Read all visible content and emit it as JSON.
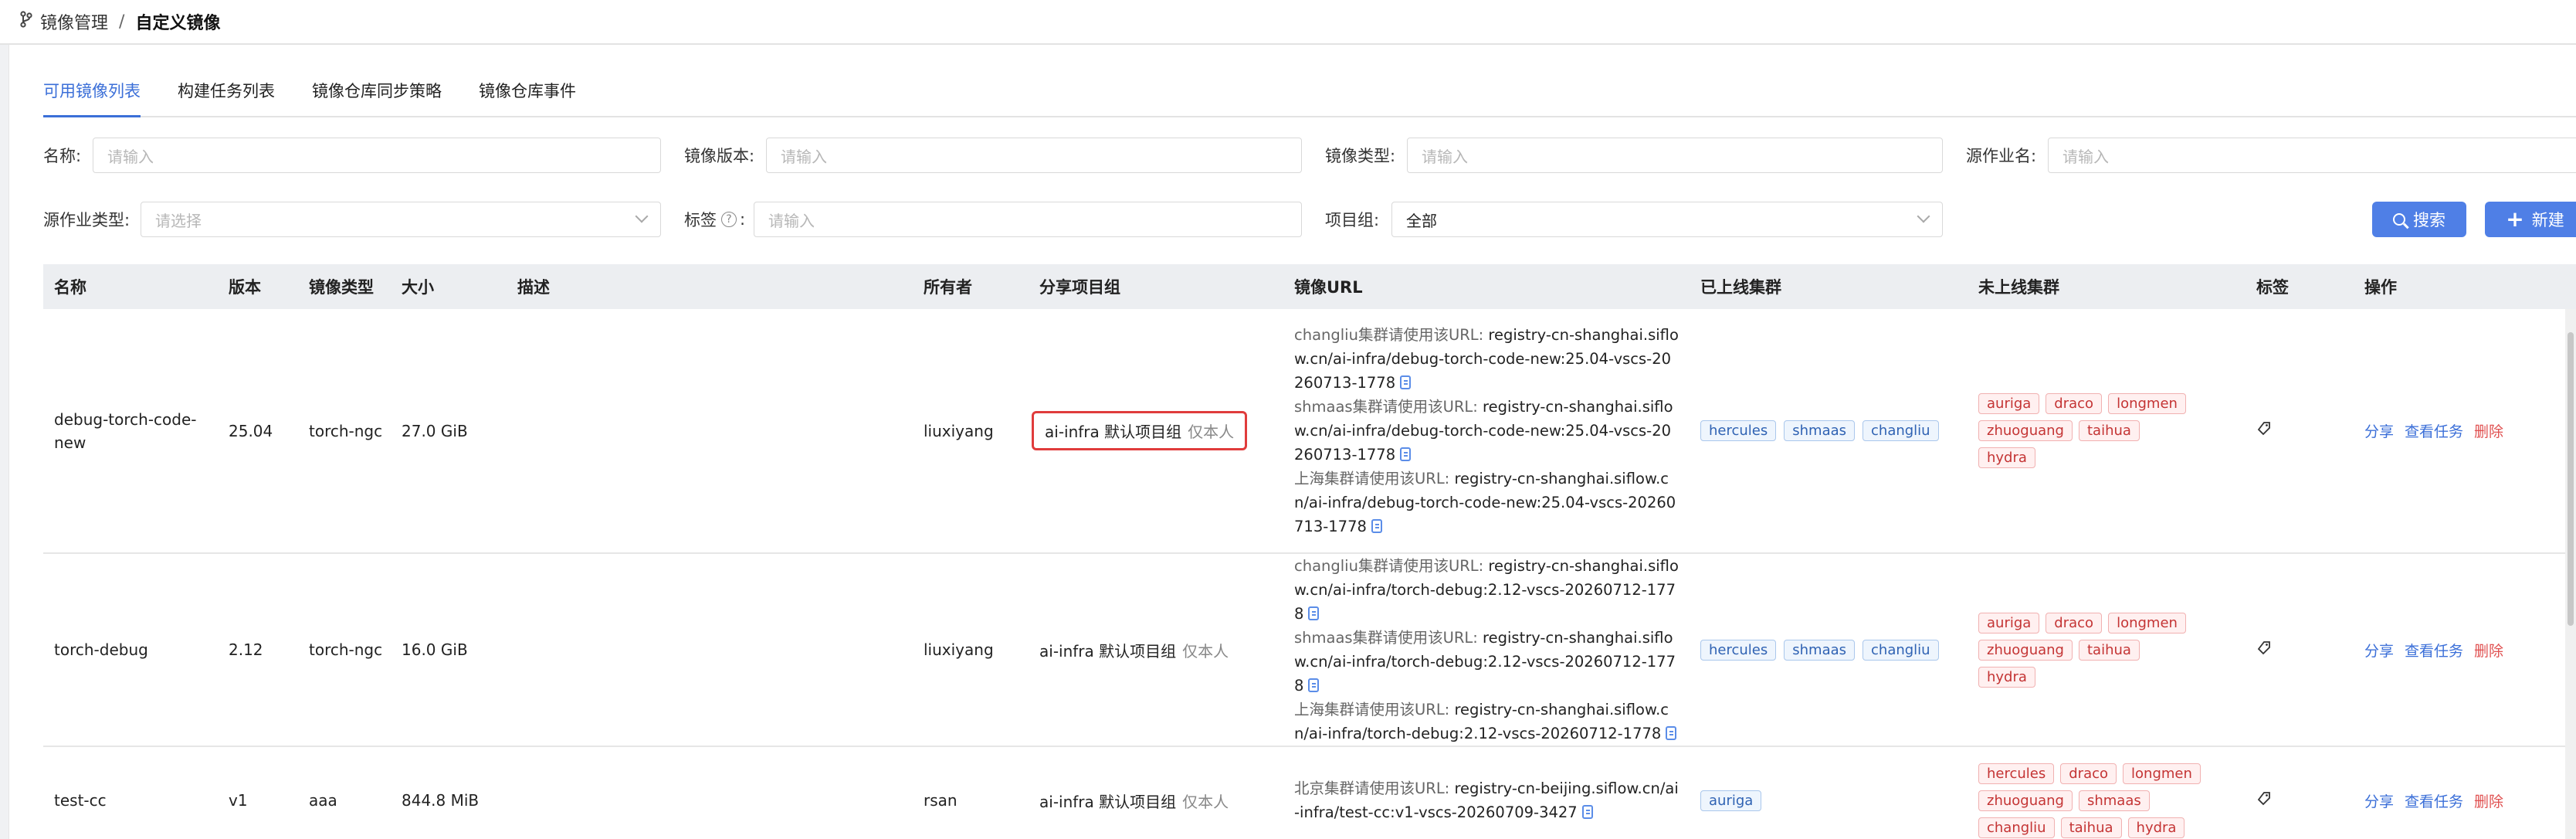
{
  "breadcrumb": {
    "parent": "镜像管理",
    "separator": "/",
    "current": "自定义镜像"
  },
  "tabs": [
    {
      "label": "可用镜像列表",
      "active": true
    },
    {
      "label": "构建任务列表",
      "active": false
    },
    {
      "label": "镜像仓库同步策略",
      "active": false
    },
    {
      "label": "镜像仓库事件",
      "active": false
    }
  ],
  "filters": {
    "name_label": "名称:",
    "name_placeholder": "请输入",
    "version_label": "镜像版本:",
    "version_placeholder": "请输入",
    "type_label": "镜像类型:",
    "type_placeholder": "请输入",
    "source_job_label": "源作业名:",
    "source_job_placeholder": "请输入",
    "source_job_type_label": "源作业类型:",
    "source_job_type_placeholder": "请选择",
    "tag_label": "标签",
    "tag_suffix": ":",
    "tag_placeholder": "请输入",
    "project_label": "项目组:",
    "project_value": "全部"
  },
  "buttons": {
    "search": "搜索",
    "create": "新建"
  },
  "columns": [
    "名称",
    "版本",
    "镜像类型",
    "大小",
    "描述",
    "所有者",
    "分享项目组",
    "镜像URL",
    "已上线集群",
    "未上线集群",
    "标签",
    "操作"
  ],
  "ops": {
    "share": "分享",
    "view_tasks": "查看任务",
    "delete": "删除"
  },
  "rows": [
    {
      "name": "debug-torch-code-new",
      "version": "25.04",
      "type": "torch-ngc",
      "size": "27.0 GiB",
      "desc": "",
      "owner": "liuxiyang",
      "share_group": "ai-infra 默认项目组",
      "share_note": "仅本人",
      "urls": [
        {
          "pre": "changliu集群请使用该URL:",
          "url": "registry-cn-shanghai.siflow.cn/ai-infra/debug-torch-code-new:25.04-vscs-20260713-1778"
        },
        {
          "pre": "shmaas集群请使用该URL:",
          "url": "registry-cn-shanghai.siflow.cn/ai-infra/debug-torch-code-new:25.04-vscs-20260713-1778"
        },
        {
          "pre": "上海集群请使用该URL:",
          "url": "registry-cn-shanghai.siflow.cn/ai-infra/debug-torch-code-new:25.04-vscs-20260713-1778"
        }
      ],
      "online": [
        "hercules",
        "shmaas",
        "changliu"
      ],
      "offline": [
        "auriga",
        "draco",
        "longmen",
        "zhuoguang",
        "taihua",
        "hydra"
      ]
    },
    {
      "name": "torch-debug",
      "version": "2.12",
      "type": "torch-ngc",
      "size": "16.0 GiB",
      "desc": "",
      "owner": "liuxiyang",
      "share_group": "ai-infra 默认项目组",
      "share_note": "仅本人",
      "urls": [
        {
          "pre": "changliu集群请使用该URL:",
          "url": "registry-cn-shanghai.siflow.cn/ai-infra/torch-debug:2.12-vscs-20260712-1778"
        },
        {
          "pre": "shmaas集群请使用该URL:",
          "url": "registry-cn-shanghai.siflow.cn/ai-infra/torch-debug:2.12-vscs-20260712-1778"
        },
        {
          "pre": "上海集群请使用该URL:",
          "url": "registry-cn-shanghai.siflow.cn/ai-infra/torch-debug:2.12-vscs-20260712-1778"
        }
      ],
      "online": [
        "hercules",
        "shmaas",
        "changliu"
      ],
      "offline": [
        "auriga",
        "draco",
        "longmen",
        "zhuoguang",
        "taihua",
        "hydra"
      ]
    },
    {
      "name": "test-cc",
      "version": "v1",
      "type": "aaa",
      "size": "844.8 MiB",
      "desc": "",
      "owner": "rsan",
      "share_group": "ai-infra 默认项目组",
      "share_note": "仅本人",
      "urls": [
        {
          "pre": "北京集群请使用该URL:",
          "url": "registry-cn-beijing.siflow.cn/ai-infra/test-cc:v1-vscs-20260709-3427"
        }
      ],
      "online": [
        "auriga"
      ],
      "offline": [
        "hercules",
        "draco",
        "longmen",
        "zhuoguang",
        "shmaas",
        "changliu",
        "taihua",
        "hydra"
      ]
    }
  ]
}
